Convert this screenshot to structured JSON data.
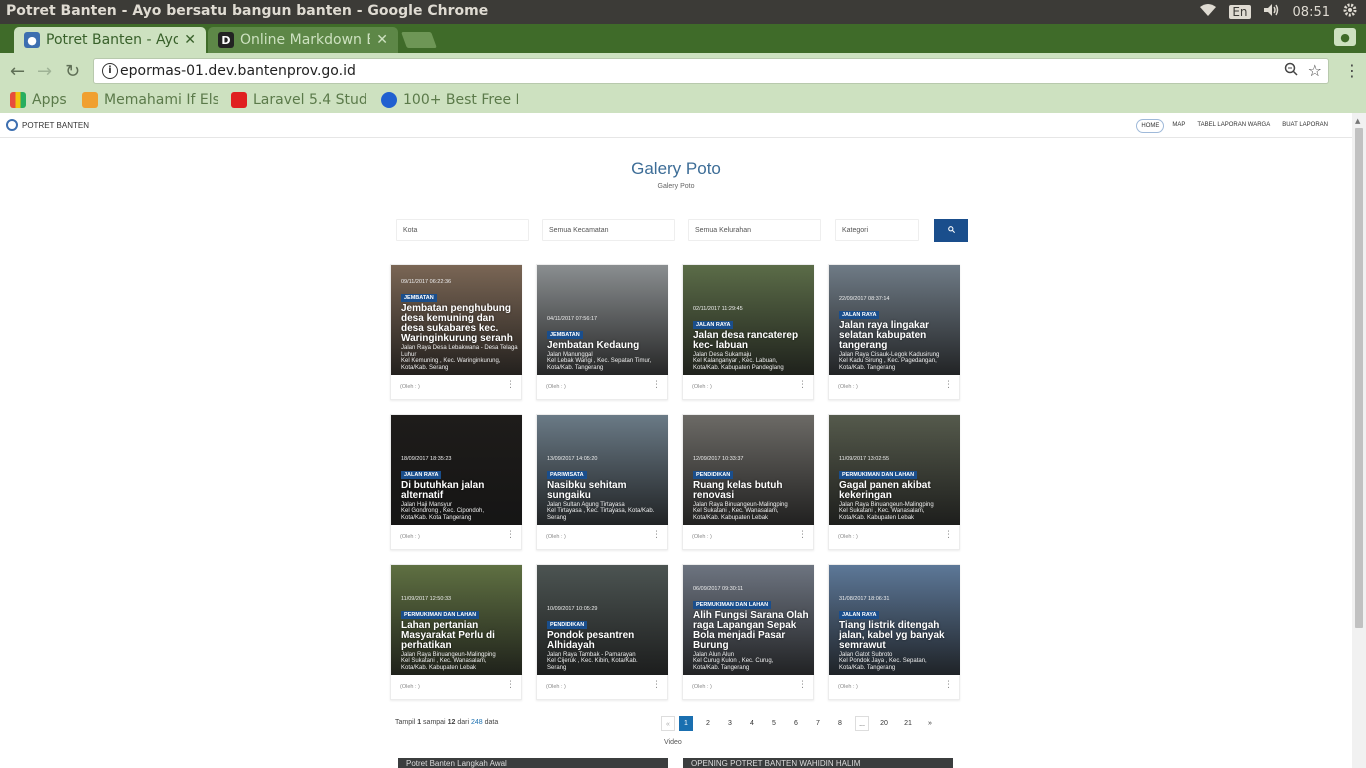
{
  "os": {
    "window_title": "Potret Banten - Ayo bersatu bangun banten - Google Chrome",
    "lang": "En",
    "time": "08:51"
  },
  "browser": {
    "tabs": [
      {
        "label": "Potret Banten - Ayo",
        "active": true
      },
      {
        "label": "Online Markdown E",
        "active": false
      }
    ],
    "url": "epormas-01.dev.bantenprov.go.id",
    "bookmarks": [
      {
        "label": "Apps",
        "icon": "apps-grid-icon",
        "color": "#e74c3c"
      },
      {
        "label": "Memahami If Els",
        "icon": "bookmark-favicon",
        "color": "#f0a030"
      },
      {
        "label": "Laravel 5.4 Stud",
        "icon": "youtube-icon",
        "color": "#e02020"
      },
      {
        "label": "100+ Best Free B",
        "icon": "c-logo-icon",
        "color": "#2060d0"
      }
    ]
  },
  "site": {
    "brand": "POTRET BANTEN",
    "nav": [
      "HOME",
      "MAP",
      "TABEL LAPORAN WARGA",
      "BUAT LAPORAN"
    ],
    "title": "Galery Poto",
    "subtitle": "Galery Poto",
    "filters": [
      "Kota",
      "Semua Kecamatan",
      "Semua Kelurahan",
      "Kategori"
    ],
    "search_icon": "search-icon"
  },
  "cards": [
    {
      "date": "09/11/2017 06:22:36",
      "category": "JEMBATAN",
      "title": "Jembatan penghubung desa kemuning dan desa sukabares kec. Waringinkurung seranh",
      "addr": [
        "Jalan Raya Desa Lebakwana - Desa Telaga Luhur",
        "Kel Kemuning , Kec. Waringinkurung,",
        "Kota/Kab. Serang"
      ],
      "oleh": "(Oleh : )",
      "bg": "#7a6655"
    },
    {
      "date": "04/11/2017 07:56:17",
      "category": "JEMBATAN",
      "title": "Jembatan Kedaung",
      "addr": [
        "Jalan Manunggal",
        "Kel Lebak Wangi , Kec. Sepatan Timur,",
        "Kota/Kab. Tangerang"
      ],
      "oleh": "(Oleh : )",
      "bg": "#8a8e90"
    },
    {
      "date": "02/11/2017 11:29:45",
      "category": "JALAN RAYA",
      "title": "Jalan desa rancaterep kec- labuan",
      "addr": [
        "Jalan Desa Sukamaju",
        "Kel Kalanganyar , Kec. Labuan,",
        "Kota/Kab. Kabupaten Pandeglang"
      ],
      "oleh": "(Oleh : )",
      "bg": "#5b6c48"
    },
    {
      "date": "22/09/2017 08:37:14",
      "category": "JALAN RAYA",
      "title": "Jalan raya lingakar selatan kabupaten tangerang",
      "addr": [
        "Jalan Raya Cisauk-Legok Kadusirung",
        "Kel Kadu Sirung , Kec. Pagedangan,",
        "Kota/Kab. Tangerang"
      ],
      "oleh": "(Oleh : )",
      "bg": "#6f7b86"
    },
    {
      "date": "18/09/2017 18:35:23",
      "category": "JALAN RAYA",
      "title": "Di butuhkan jalan alternatif",
      "addr": [
        "Jalan Haji Mansyur",
        "Kel Gondrong , Kec. Cipondoh,",
        "Kota/Kab. Kota Tangerang"
      ],
      "oleh": "(Oleh : )",
      "bg": "#1e1c1a"
    },
    {
      "date": "13/09/2017 14:05:20",
      "category": "PARIWISATA",
      "title": "Nasibku sehitam sungaiku",
      "addr": [
        "Jalan Sultan Agung Tirtayasa",
        "Kel Tirtayasa , Kec. Tirtayasa, Kota/Kab.",
        "Serang"
      ],
      "oleh": "(Oleh : )",
      "bg": "#6a7a86"
    },
    {
      "date": "12/09/2017 10:33:37",
      "category": "PENDIDIKAN",
      "title": "Ruang kelas butuh renovasi",
      "addr": [
        "Jalan Raya Binuangeun-Malingping",
        "Kel Sukatani , Kec. Wanasalam,",
        "Kota/Kab. Kabupaten Lebak"
      ],
      "oleh": "(Oleh : )",
      "bg": "#6c6a66"
    },
    {
      "date": "11/09/2017 13:02:55",
      "category": "PERMUKIMAN DAN LAHAN",
      "title": "Gagal panen akibat kekeringan",
      "addr": [
        "Jalan Raya Binuangeun-Malingping",
        "Kel Sukatani , Kec. Wanasalam,",
        "Kota/Kab. Kabupaten Lebak"
      ],
      "oleh": "(Oleh : )",
      "bg": "#555a4c"
    },
    {
      "date": "11/09/2017 12:50:33",
      "category": "PERMUKIMAN DAN LAHAN",
      "title": "Lahan pertanian Masyarakat Perlu di perhatikan",
      "addr": [
        "Jalan Raya Binuangeun-Malingping",
        "Kel Sukatani , Kec. Wanasalam,",
        "Kota/Kab. Kabupaten Lebak"
      ],
      "oleh": "(Oleh : )",
      "bg": "#5f7042"
    },
    {
      "date": "10/09/2017 10:05:29",
      "category": "PENDIDIKAN",
      "title": "Pondok pesantren Alhidayah",
      "addr": [
        "Jalan Raya Tambak - Pamarayan",
        "Kel Cijeruk , Kec. Kibin, Kota/Kab.",
        "Serang"
      ],
      "oleh": "(Oleh : )",
      "bg": "#4c5452"
    },
    {
      "date": "06/09/2017 09:30:11",
      "category": "PERMUKIMAN DAN LAHAN",
      "title": "Alih Fungsi Sarana Olah raga Lapangan Sepak Bola menjadi Pasar Burung",
      "addr": [
        "Jalan Alun Alun",
        "Kel Curug Kulon , Kec. Curug,",
        "Kota/Kab. Tangerang"
      ],
      "oleh": "(Oleh : )",
      "bg": "#6d7480"
    },
    {
      "date": "31/08/2017 18:06:31",
      "category": "JALAN RAYA",
      "title": "Tiang listrik ditengah jalan, kabel yg banyak semrawut",
      "addr": [
        "Jalan Gatot Subroto",
        "Kel Pondok Jaya , Kec. Sepatan,",
        "Kota/Kab. Tangerang"
      ],
      "oleh": "(Oleh : )",
      "bg": "#5d7898"
    }
  ],
  "pagination": {
    "info_prefix": "Tampil",
    "from": "1",
    "mid": "sampai",
    "to": "12",
    "of_word": "dari",
    "total": "248",
    "suffix": "data",
    "prev": "«",
    "next": "»",
    "pages": [
      "1",
      "2",
      "3",
      "4",
      "5",
      "6",
      "7",
      "8",
      "...",
      "20",
      "21"
    ],
    "current": "1"
  },
  "video": {
    "label": "Video",
    "items": [
      "Potret Banten Langkah Awal",
      "OPENING POTRET BANTEN WAHIDIN HALIM"
    ]
  }
}
